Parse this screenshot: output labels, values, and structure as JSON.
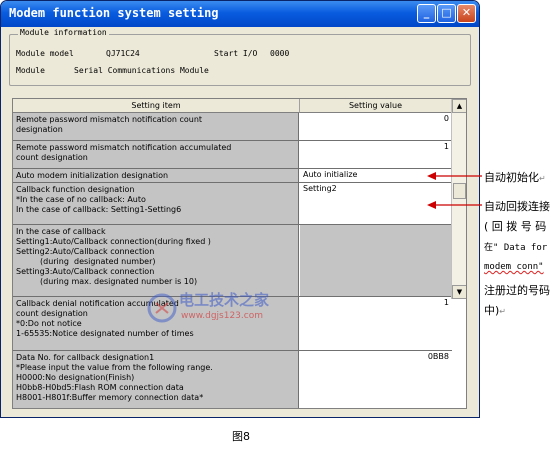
{
  "window": {
    "title": "Modem function system setting",
    "controls": {
      "minimize": "_",
      "maximize": "□",
      "close": "✕"
    }
  },
  "module_info": {
    "legend": "Module information",
    "model_label": "Module model",
    "model_value": "QJ71C24",
    "start_io_label": "Start I/O",
    "start_io_value": "0000",
    "module_label": "Module",
    "module_value": "Serial Communications Module"
  },
  "table": {
    "headers": [
      "Setting item",
      "Setting value"
    ],
    "rows": [
      {
        "item": "Remote password mismatch notification count\ndesignation",
        "value": "0"
      },
      {
        "item": "Remote password mismatch notification accumulated\ncount designation",
        "value": "1"
      },
      {
        "item": "Auto modem initialization designation",
        "value": "Auto initialize"
      },
      {
        "item": "Callback function designation\n*In the case of no callback: Auto\nIn the case of callback: Setting1-Setting6",
        "value": "Setting2"
      },
      {
        "item": "In the case of callback\nSetting1:Auto/Callback connection(during fixed )\nSetting2:Auto/Callback connection",
        "indent1": "(during  designated number)",
        "item2": "Setting3:Auto/Callback connection",
        "indent2": "(during max. designated number is 10)",
        "value": ""
      },
      {
        "item": "Callback denial notification accumulated\ncount designation\n*0:Do not notice\n1-65535:Notice designated number of times",
        "value": "1"
      },
      {
        "item": "Data No. for callback designation1\n*Please input the value from the following range.\nH0000:No designation(Finish)\nH0bb8-H0bd5:Flash ROM connection data\nH8001-H801f:Buffer memory connection data*",
        "value": "0BB8"
      }
    ]
  },
  "scrollbar": {
    "up": "▲",
    "down": "▼"
  },
  "watermark": {
    "main": "电工技术之家",
    "sub": "www.dgjs123.com"
  },
  "annotations": {
    "a1": "自动初始化",
    "a2_line1": "自动回拨连接",
    "a2_line2": "( 回 拨 号 码",
    "a2_line3": "在\" Data  for",
    "a2_line4": "modem  conn\"",
    "a2_line5": "注册过的号码",
    "a2_line6": "中)",
    "return_mark": "↵",
    "arrow_color": "#cc0000"
  },
  "caption": "图8"
}
